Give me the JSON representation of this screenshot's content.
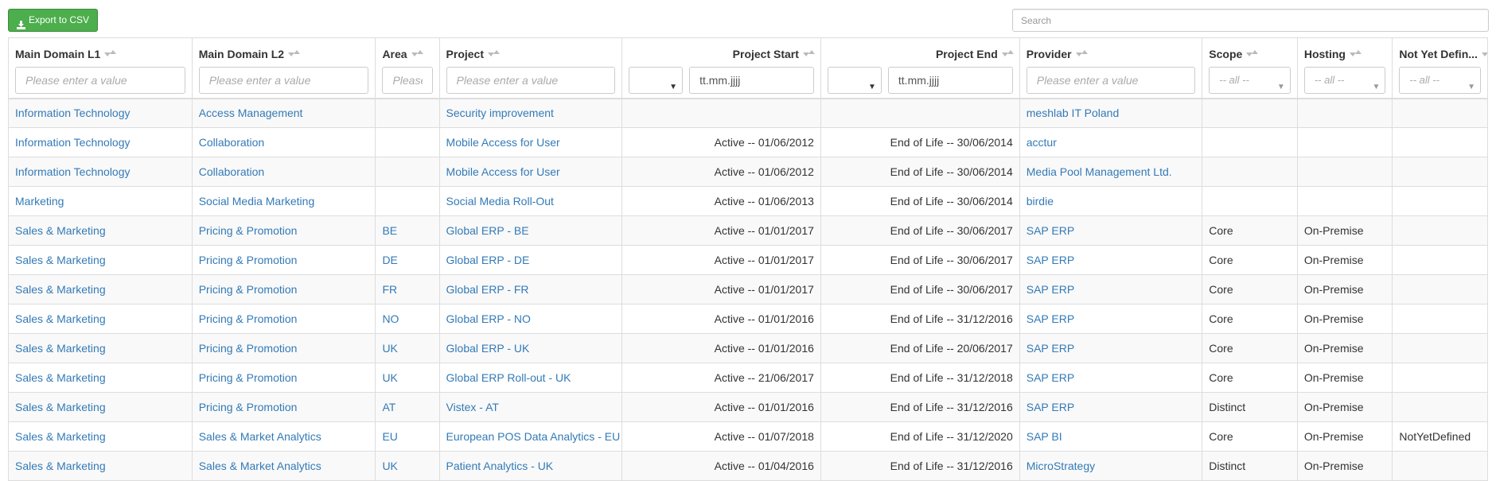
{
  "toolbar": {
    "export_label": "Export to CSV",
    "search_placeholder": "Search"
  },
  "columns": [
    {
      "label": "Main Domain L1",
      "filter": "text",
      "placeholder": "Please enter a value"
    },
    {
      "label": "Main Domain L2",
      "filter": "text",
      "placeholder": "Please enter a value"
    },
    {
      "label": "Area",
      "filter": "text",
      "placeholder": "Please enter a value"
    },
    {
      "label": "Project",
      "filter": "text",
      "placeholder": "Please enter a value"
    },
    {
      "label": "Project Start",
      "filter": "date",
      "date_placeholder": "tt.mm.jjjj"
    },
    {
      "label": "Project End",
      "filter": "date",
      "date_placeholder": "tt.mm.jjjj"
    },
    {
      "label": "Provider",
      "filter": "text",
      "placeholder": "Please enter a value"
    },
    {
      "label": "Scope",
      "filter": "select",
      "select_value": "-- all --"
    },
    {
      "label": "Hosting",
      "filter": "select",
      "select_value": "-- all --"
    },
    {
      "label": "Not Yet Defin...",
      "filter": "select",
      "select_value": "-- all --"
    }
  ],
  "rows": [
    [
      "Information Technology",
      "Access Management",
      "",
      "Security improvement",
      "",
      "",
      "meshlab IT Poland",
      "",
      "",
      ""
    ],
    [
      "Information Technology",
      "Collaboration",
      "",
      "Mobile Access for User",
      "Active -- 01/06/2012",
      "End of Life -- 30/06/2014",
      "acctur",
      "",
      "",
      ""
    ],
    [
      "Information Technology",
      "Collaboration",
      "",
      "Mobile Access for User",
      "Active -- 01/06/2012",
      "End of Life -- 30/06/2014",
      "Media Pool Management Ltd.",
      "",
      "",
      ""
    ],
    [
      "Marketing",
      "Social Media Marketing",
      "",
      "Social Media Roll-Out",
      "Active -- 01/06/2013",
      "End of Life -- 30/06/2014",
      "birdie",
      "",
      "",
      ""
    ],
    [
      "Sales & Marketing",
      "Pricing & Promotion",
      "BE",
      "Global ERP - BE",
      "Active -- 01/01/2017",
      "End of Life -- 30/06/2017",
      "SAP ERP",
      "Core",
      "On-Premise",
      ""
    ],
    [
      "Sales & Marketing",
      "Pricing & Promotion",
      "DE",
      "Global ERP - DE",
      "Active -- 01/01/2017",
      "End of Life -- 30/06/2017",
      "SAP ERP",
      "Core",
      "On-Premise",
      ""
    ],
    [
      "Sales & Marketing",
      "Pricing & Promotion",
      "FR",
      "Global ERP - FR",
      "Active -- 01/01/2017",
      "End of Life -- 30/06/2017",
      "SAP ERP",
      "Core",
      "On-Premise",
      ""
    ],
    [
      "Sales & Marketing",
      "Pricing & Promotion",
      "NO",
      "Global ERP - NO",
      "Active -- 01/01/2016",
      "End of Life -- 31/12/2016",
      "SAP ERP",
      "Core",
      "On-Premise",
      ""
    ],
    [
      "Sales & Marketing",
      "Pricing & Promotion",
      "UK",
      "Global ERP - UK",
      "Active -- 01/01/2016",
      "End of Life -- 20/06/2017",
      "SAP ERP",
      "Core",
      "On-Premise",
      ""
    ],
    [
      "Sales & Marketing",
      "Pricing & Promotion",
      "UK",
      "Global ERP Roll-out - UK",
      "Active -- 21/06/2017",
      "End of Life -- 31/12/2018",
      "SAP ERP",
      "Core",
      "On-Premise",
      ""
    ],
    [
      "Sales & Marketing",
      "Pricing & Promotion",
      "AT",
      "Vistex - AT",
      "Active -- 01/01/2016",
      "End of Life -- 31/12/2016",
      "SAP ERP",
      "Distinct",
      "On-Premise",
      ""
    ],
    [
      "Sales & Marketing",
      "Sales & Market Analytics",
      "EU",
      "European POS Data Analytics - EU",
      "Active -- 01/07/2018",
      "End of Life -- 31/12/2020",
      "SAP BI",
      "Core",
      "On-Premise",
      "NotYetDefined"
    ],
    [
      "Sales & Marketing",
      "Sales & Market Analytics",
      "UK",
      "Patient Analytics - UK",
      "Active -- 01/04/2016",
      "End of Life -- 31/12/2016",
      "MicroStrategy",
      "Distinct",
      "On-Premise",
      ""
    ]
  ]
}
